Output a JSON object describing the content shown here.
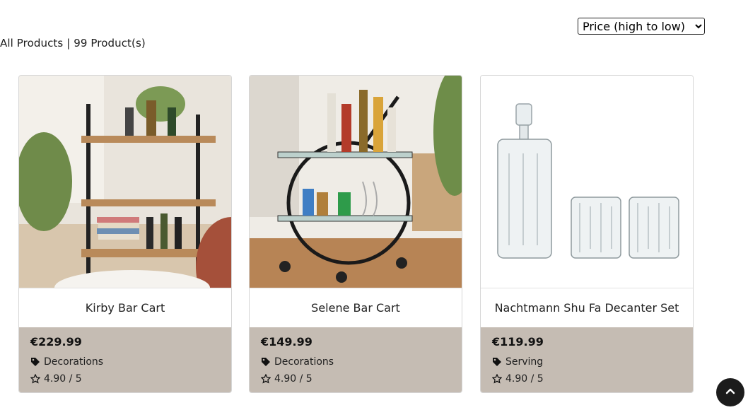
{
  "sort": {
    "selected": "Price (high to low)"
  },
  "heading": {
    "text": "All Products | 99 Product(s)"
  },
  "products": [
    {
      "name": "Kirby Bar Cart",
      "price": "€229.99",
      "category": "Decorations",
      "rating": "4.90 / 5",
      "image_icon": "bar-cart-photo"
    },
    {
      "name": "Selene Bar Cart",
      "price": "€149.99",
      "category": "Decorations",
      "rating": "4.90 / 5",
      "image_icon": "round-bar-cart-photo"
    },
    {
      "name": "Nachtmann Shu Fa Decanter Set",
      "price": "€119.99",
      "category": "Serving",
      "rating": "4.90 / 5",
      "image_icon": "decanter-set-photo"
    }
  ],
  "colors": {
    "info_panel": "#c5bcb3",
    "scroll_button": "#1c1c1c"
  },
  "icons": {
    "category": "tag-icon",
    "rating": "star-icon",
    "scroll_top": "chevron-up-icon"
  }
}
